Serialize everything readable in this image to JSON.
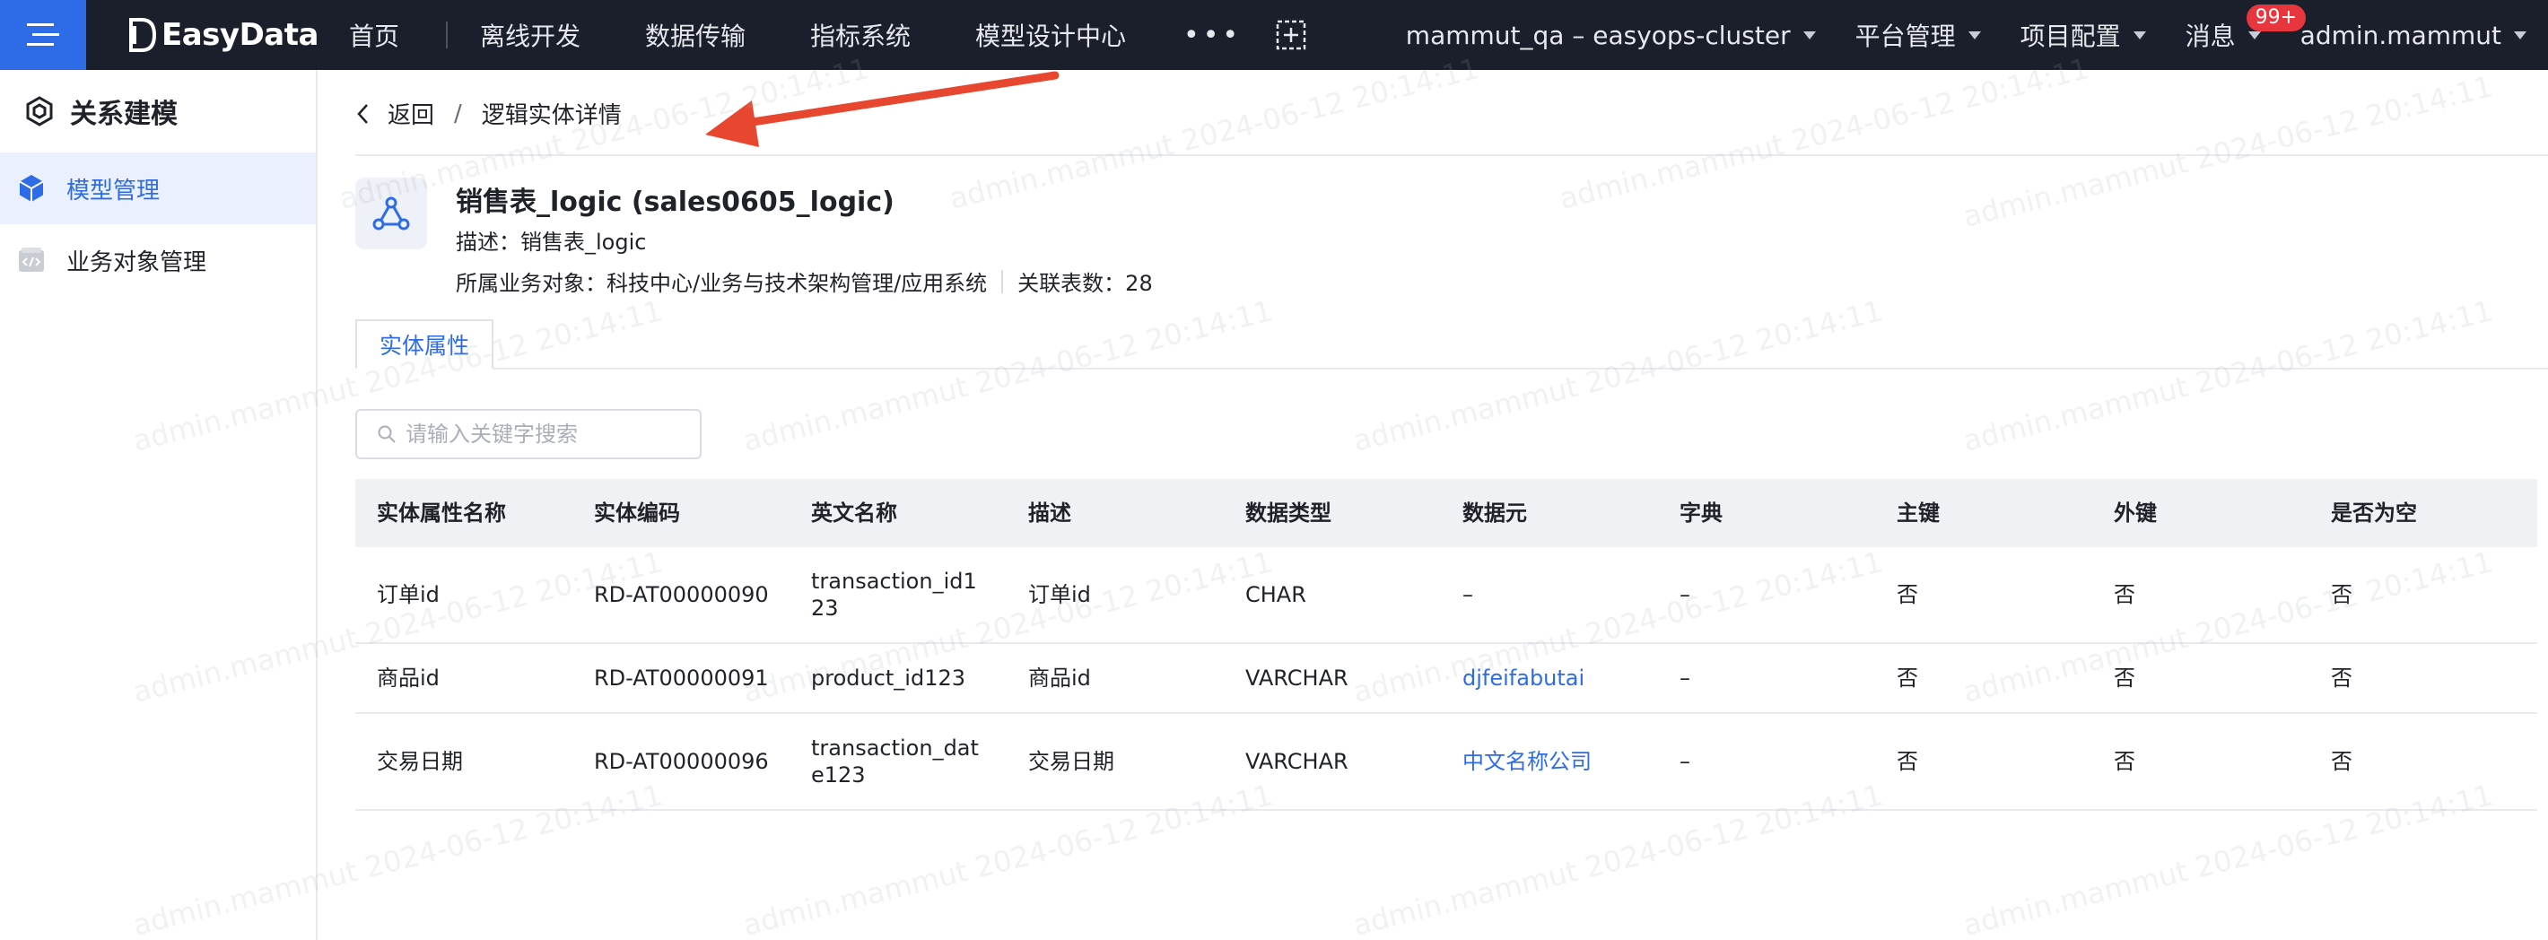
{
  "topbar": {
    "logo_text": "EasyData",
    "nav": [
      "首页",
      "离线开发",
      "数据传输",
      "指标系统",
      "模型设计中心"
    ],
    "more": "•••",
    "cluster": "mammut_qa – easyops-cluster",
    "platform": "平台管理",
    "project": "项目配置",
    "messages": "消息",
    "badge": "99+",
    "user": "admin.mammut"
  },
  "sidebar": {
    "title": "关系建模",
    "items": [
      "模型管理",
      "业务对象管理"
    ]
  },
  "breadcrumb": {
    "back": "返回",
    "separator": "/",
    "current": "逻辑实体详情"
  },
  "entity": {
    "title": "销售表_logic (sales0605_logic)",
    "desc": "描述：销售表_logic",
    "owner": "所属业务对象：科技中心/业务与技术架构管理/应用系统",
    "count": "关联表数：28"
  },
  "tab": "实体属性",
  "search": {
    "placeholder": "请输入关键字搜索"
  },
  "table": {
    "headers": [
      "实体属性名称",
      "实体编码",
      "英文名称",
      "描述",
      "数据类型",
      "数据元",
      "字典",
      "主键",
      "外键",
      "是否为空"
    ],
    "rows": [
      [
        "订单id",
        "RD-AT00000090",
        "transaction_id123",
        "订单id",
        "CHAR",
        "–",
        "–",
        "否",
        "否",
        "否"
      ],
      [
        "商品id",
        "RD-AT00000091",
        "product_id123",
        "商品id",
        "VARCHAR",
        "djfeifabutai",
        "–",
        "否",
        "否",
        "否"
      ],
      [
        "交易日期",
        "RD-AT00000096",
        "transaction_date123",
        "交易日期",
        "VARCHAR",
        "中文名称公司",
        "–",
        "否",
        "否",
        "否"
      ]
    ]
  },
  "watermark": "admin.mammut 2024-06-12 20:14:11",
  "colors": {
    "accent": "#2d6ce6",
    "topbar": "#1b1f2b",
    "badge": "#e8363e",
    "arrow": "#e8472f"
  }
}
